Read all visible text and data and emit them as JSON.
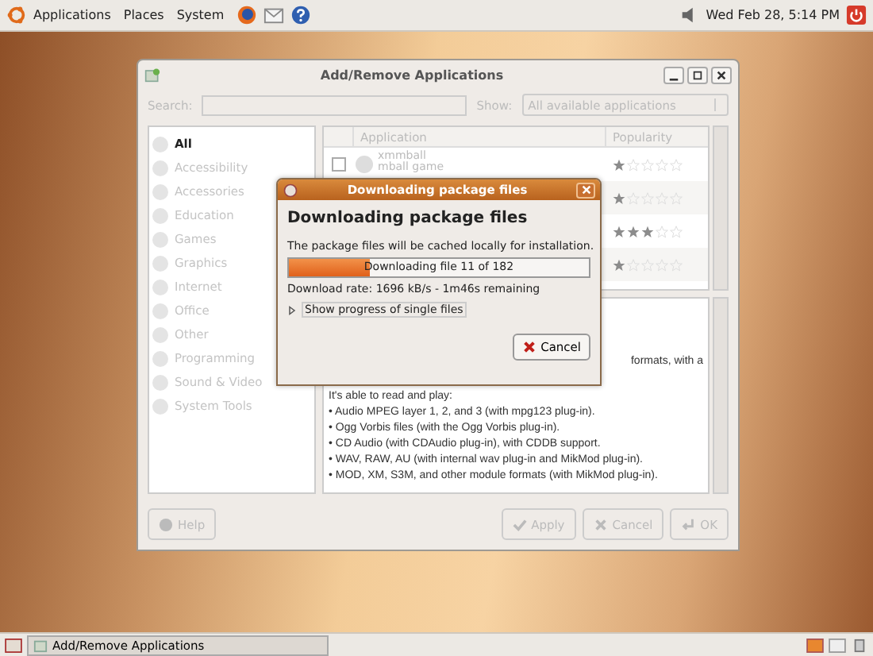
{
  "top_panel": {
    "menus": [
      "Applications",
      "Places",
      "System"
    ],
    "clock": "Wed Feb 28,  5:14 PM"
  },
  "main_window": {
    "title": "Add/Remove Applications",
    "disabled": true,
    "search_label": "Search:",
    "show_label": "Show:",
    "show_value": "All available applications",
    "categories": [
      {
        "label": "All",
        "selected": true
      },
      {
        "label": "Accessibility",
        "selected": false
      },
      {
        "label": "Accessories",
        "selected": false
      },
      {
        "label": "Education",
        "selected": false
      },
      {
        "label": "Games",
        "selected": false
      },
      {
        "label": "Graphics",
        "selected": false
      },
      {
        "label": "Internet",
        "selected": false
      },
      {
        "label": "Office",
        "selected": false
      },
      {
        "label": "Other",
        "selected": false
      },
      {
        "label": "Programming",
        "selected": false
      },
      {
        "label": "Sound & Video",
        "selected": false
      },
      {
        "label": "System Tools",
        "selected": false
      }
    ],
    "columns": [
      "Application",
      "Popularity"
    ],
    "apps": [
      {
        "name": "xmmball",
        "description": "mball game",
        "checked": false,
        "stars": 1
      },
      {
        "stars": 1
      },
      {
        "stars": 3
      },
      {
        "stars": 1
      }
    ],
    "description": {
      "fragment": "formats, with a",
      "intro": "It's able to read and play:",
      "bullets": [
        "• Audio MPEG layer 1, 2, and 3 (with mpg123 plug-in).",
        "• Ogg Vorbis files (with the Ogg Vorbis plug-in).",
        "• CD Audio (with CDAudio plug-in), with CDDB support.",
        "• WAV, RAW, AU (with internal wav plug-in and MikMod plug-in).",
        "• MOD, XM, S3M, and other module formats (with MikMod plug-in)."
      ]
    },
    "buttons": {
      "help": "Help",
      "apply": "Apply",
      "cancel": "Cancel",
      "ok": "OK"
    }
  },
  "dialog": {
    "title": "Downloading package files",
    "heading": "Downloading package files",
    "message": "The package files will be cached locally for installation.",
    "progress": {
      "level": 0.27,
      "text": "Downloading file 11 of 182"
    },
    "rate": "Download rate: 1696 kB/s - 1m46s remaining",
    "expander": {
      "label": "Show progress of single files",
      "expanded": false
    },
    "cancel": "Cancel"
  },
  "taskbar": {
    "item": "Add/Remove Applications"
  }
}
